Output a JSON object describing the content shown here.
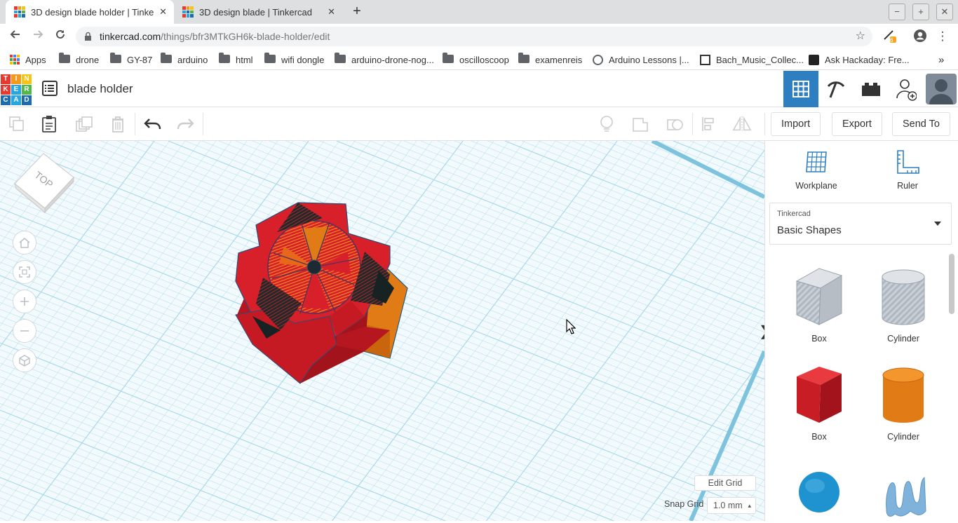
{
  "browser": {
    "tabs": [
      {
        "title": "3D design blade holder | Tinker",
        "close": "✕"
      },
      {
        "title": "3D design blade | Tinkercad",
        "close": "✕"
      }
    ],
    "new_tab": "+",
    "window_buttons": {
      "minimize": "−",
      "maximize": "+",
      "close": "✕"
    },
    "url_domain": "tinkercad.com",
    "url_path": "/things/bfr3MTkGH6k-blade-holder/edit",
    "extension_badge": "6",
    "bookmarks": [
      {
        "label": "Apps",
        "icon": "apps-grid-icon"
      },
      {
        "label": "drone",
        "icon": "folder-icon"
      },
      {
        "label": "GY-87",
        "icon": "folder-icon"
      },
      {
        "label": "arduino",
        "icon": "folder-icon"
      },
      {
        "label": "html",
        "icon": "folder-icon"
      },
      {
        "label": "wifi dongle",
        "icon": "folder-icon"
      },
      {
        "label": "arduino-drone-nog...",
        "icon": "folder-icon"
      },
      {
        "label": "oscilloscoop",
        "icon": "folder-icon"
      },
      {
        "label": "examenreis",
        "icon": "folder-icon"
      },
      {
        "label": "Arduino Lessons |...",
        "icon": "globe-icon"
      },
      {
        "label": "Bach_Music_Collec...",
        "icon": "site-icon"
      },
      {
        "label": "Ask Hackaday: Fre...",
        "icon": "hackaday-icon"
      }
    ],
    "more_bookmarks": "»"
  },
  "app": {
    "logo_letters": [
      "T",
      "I",
      "N",
      "K",
      "E",
      "R",
      "C",
      "A",
      "D"
    ],
    "design_name": "blade holder",
    "header_modes": [
      "3d-design-grid-icon",
      "pickaxe-icon",
      "bricks-icon",
      "add-user-icon"
    ]
  },
  "toolbar": {
    "import_label": "Import",
    "export_label": "Export",
    "send_to_label": "Send To"
  },
  "viewport": {
    "viewcube_label": "TOP",
    "edit_grid_label": "Edit Grid",
    "snap_grid_label": "Snap Grid",
    "snap_value": "1.0 mm",
    "snap_arrow": "▴",
    "collapse_handle": "❯"
  },
  "panel": {
    "workplane_label": "Workplane",
    "ruler_label": "Ruler",
    "library_provider": "Tinkercad",
    "library_name": "Basic Shapes",
    "shapes": [
      {
        "label": "Box",
        "style": "hole",
        "color": "#b8bec6"
      },
      {
        "label": "Cylinder",
        "style": "hole",
        "color": "#b8bec6"
      },
      {
        "label": "Box",
        "style": "solid",
        "color": "#d0202a"
      },
      {
        "label": "Cylinder",
        "style": "solid",
        "color": "#e07b16"
      },
      {
        "label": "",
        "style": "sphere",
        "color": "#1f93d0"
      },
      {
        "label": "",
        "style": "scribble",
        "color": "#7fb3dc"
      }
    ]
  },
  "colors": {
    "accent_blue": "#2d7fc1",
    "model_red": "#d0202a",
    "model_orange": "#e07b16",
    "grid_line": "#a9d9ea"
  }
}
